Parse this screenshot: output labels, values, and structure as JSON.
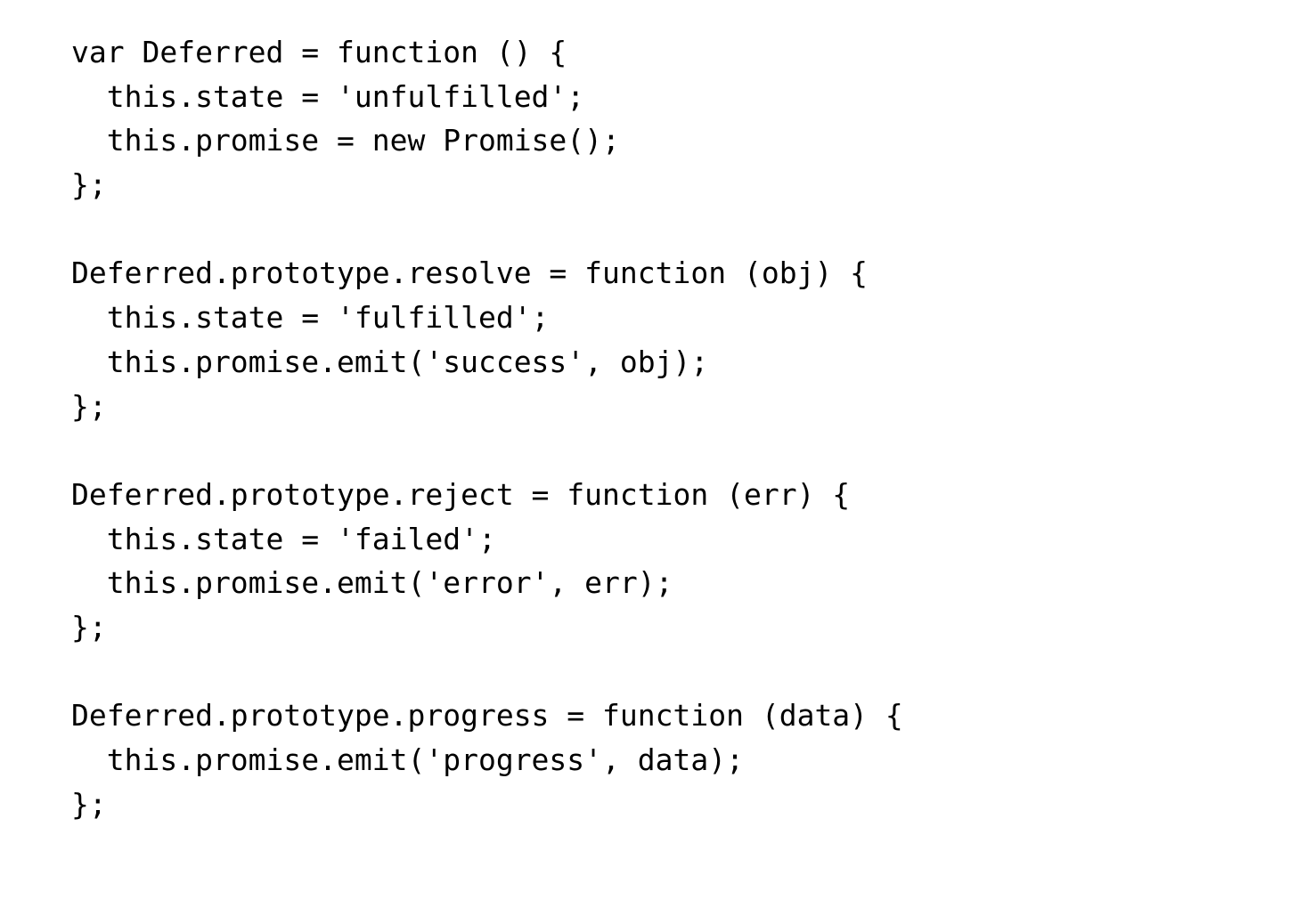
{
  "code": {
    "language": "javascript",
    "text_color": "#000000",
    "background": "#ffffff",
    "lines": [
      "var Deferred = function () {",
      "  this.state = 'unfulfilled';",
      "  this.promise = new Promise();",
      "};",
      "",
      "Deferred.prototype.resolve = function (obj) {",
      "  this.state = 'fulfilled';",
      "  this.promise.emit('success', obj);",
      "};",
      "",
      "Deferred.prototype.reject = function (err) {",
      "  this.state = 'failed';",
      "  this.promise.emit('error', err);",
      "};",
      "",
      "Deferred.prototype.progress = function (data) {",
      "  this.promise.emit('progress', data);",
      "};"
    ]
  }
}
